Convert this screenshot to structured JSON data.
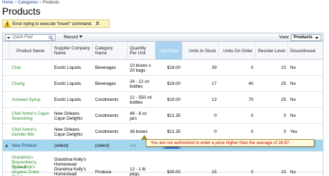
{
  "breadcrumb": {
    "home": "Home",
    "categories": "Categories",
    "products": "Products",
    "separator": ">"
  },
  "page_title": "Products",
  "error_bar": {
    "message": "Error trying to execute \"Insert\" command.",
    "close_label": "X"
  },
  "toolbar": {
    "quick_find_placeholder": "Quick Find",
    "record_label": "Record",
    "view_label": "View:",
    "view_value": "Products"
  },
  "grid": {
    "columns": [
      "Product Name",
      "Supplier Company Name",
      "Category Name",
      "Quantity Per Unit",
      "Unit Price",
      "Units In Stock",
      "Units On Order",
      "Reorder Level",
      "Discontinued"
    ],
    "rows": [
      {
        "product": "Chai",
        "supplier": "Exotic Liquids",
        "category": "Beverages",
        "quantity": "10 boxes x 20 bags",
        "price": "$18.00",
        "stock": "39",
        "on_order": "0",
        "reorder": "10",
        "discontinued": "No"
      },
      {
        "product": "Chang",
        "supplier": "Exotic Liquids",
        "category": "Beverages",
        "quantity": "24 - 12 oz bottles",
        "price": "$19.00",
        "stock": "17",
        "on_order": "40",
        "reorder": "25",
        "discontinued": "No"
      },
      {
        "product": "Aniseed Syrup",
        "supplier": "Exotic Liquids",
        "category": "Condiments",
        "quantity": "12 - 550 ml bottles",
        "price": "$10.00",
        "stock": "13",
        "on_order": "70",
        "reorder": "25",
        "discontinued": "No"
      },
      {
        "product": "Chef Anton's Cajun Seasoning",
        "supplier": "New Orleans Cajun Delights",
        "category": "Condiments",
        "quantity": "48 - 6 oz jars",
        "price": "$21.35",
        "stock": "0",
        "on_order": "0",
        "reorder": "0",
        "discontinued": "No"
      },
      {
        "product": "Chef Anton's Gumbo Mix",
        "supplier": "New Orleans Cajun Delights",
        "category": "Condiments",
        "quantity": "36 boxes",
        "price": "$21.35",
        "stock": "0",
        "on_order": "0",
        "reorder": "0",
        "discontinued": "Yes"
      },
      {
        "product": "New Product",
        "supplier": "(select)",
        "category": "(select)",
        "quantity": "n/a",
        "price": "$30.00",
        "stock": "n/a",
        "on_order": "n/a",
        "reorder": "n/a",
        "discontinued": "n/a"
      },
      {
        "product": "Grandma's Boysenberry Spread",
        "supplier": "Grandma Kelly's Homestead",
        "category": "",
        "quantity": "",
        "price": "",
        "stock": "",
        "on_order": "",
        "reorder": "",
        "discontinued": ""
      },
      {
        "product": "Uncle Bob's Organic Dried Pears",
        "supplier": "Grandma Kelly's Homestead",
        "category": "Produce",
        "quantity": "12 - 1 lb pkgs.",
        "price": "$30.00",
        "stock": "15",
        "on_order": "0",
        "reorder": "10",
        "discontinued": "No"
      }
    ]
  },
  "validation_tooltip": "You are not authorized to enter a price higher than the average of 28.87.",
  "colors": {
    "accent": "#a4d7ee",
    "sorted_header": "#a9d3ee",
    "link_green": "#2e8b2e",
    "error_text": "#c00000",
    "error_bg": "#fbf3c0"
  }
}
